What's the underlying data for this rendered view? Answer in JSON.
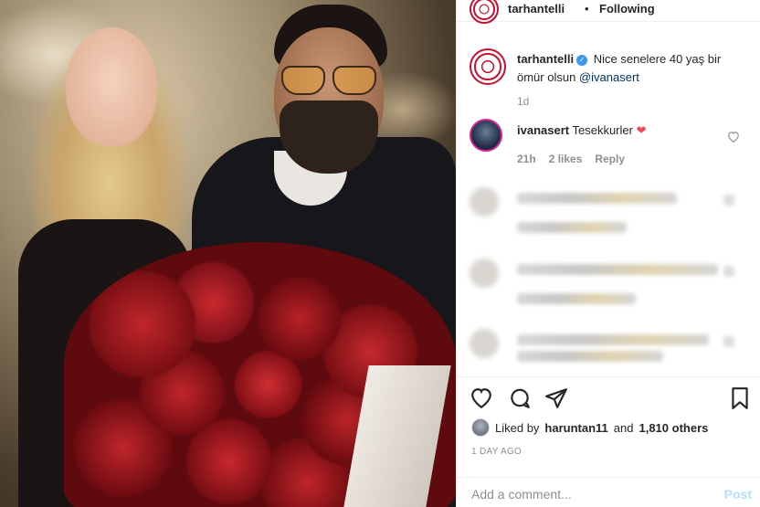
{
  "header": {
    "username": "tarhantelli",
    "follow_status": "Following"
  },
  "caption": {
    "username": "tarhantelli",
    "text": "Nice senelere 40 yaş bir ömür olsun",
    "mention": "@ivanasert",
    "age": "1d"
  },
  "reply": {
    "username": "ivanasert",
    "text": "Tesekkurler",
    "emoji": "❤",
    "age": "21h",
    "likes": "2 likes",
    "reply_label": "Reply"
  },
  "likes": {
    "prefix": "Liked by",
    "user": "haruntan11",
    "joiner": "and",
    "count": "1,810 others"
  },
  "timestamp": "1 DAY AGO",
  "comment": {
    "placeholder": "Add a comment...",
    "post_label": "Post"
  },
  "colors": {
    "accent": "#3897f0",
    "heart": "#ed4956",
    "brand_red": "#c8102e"
  }
}
